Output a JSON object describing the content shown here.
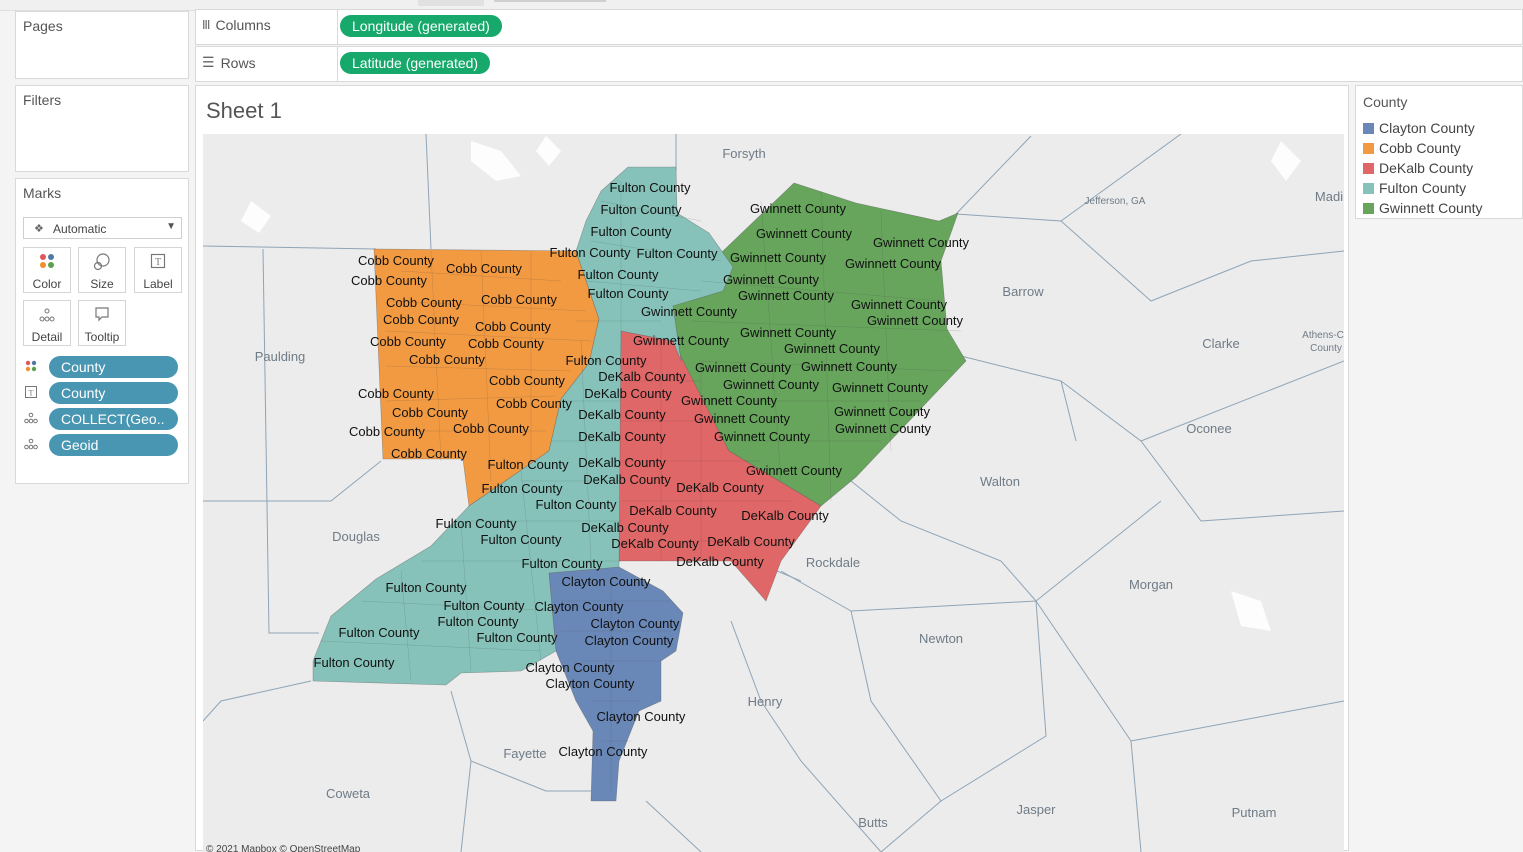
{
  "app": {
    "sheet_title": "Sheet 1"
  },
  "pages": {
    "title": "Pages"
  },
  "filters": {
    "title": "Filters"
  },
  "columns": {
    "label": "Columns",
    "pill": "Longitude (generated)"
  },
  "rows": {
    "label": "Rows",
    "pill": "Latitude (generated)"
  },
  "marks": {
    "title": "Marks",
    "mark_type": "Automatic",
    "buttons": [
      {
        "label": "Color",
        "icon": "color-dots-icon"
      },
      {
        "label": "Size",
        "icon": "size-icon"
      },
      {
        "label": "Label",
        "icon": "label-icon"
      },
      {
        "label": "Detail",
        "icon": "detail-icon"
      },
      {
        "label": "Tooltip",
        "icon": "tooltip-icon"
      }
    ],
    "fields": [
      {
        "name": "County",
        "icon": "color-dots-icon"
      },
      {
        "name": "County",
        "icon": "label-icon"
      },
      {
        "name": "COLLECT(Geo..",
        "icon": "detail-icon"
      },
      {
        "name": "Geoid",
        "icon": "detail-icon"
      }
    ]
  },
  "legend": {
    "title": "County",
    "items": [
      {
        "label": "Clayton County",
        "color": "#6a88b7"
      },
      {
        "label": "Cobb County",
        "color": "#f29a42"
      },
      {
        "label": "DeKalb County",
        "color": "#e06767"
      },
      {
        "label": "Fulton County",
        "color": "#86c2b9"
      },
      {
        "label": "Gwinnett County",
        "color": "#67a55d"
      }
    ]
  },
  "map": {
    "places": [
      "Forsyth",
      "Jefferson, GA",
      "Madi",
      "Barrow",
      "Athens-C",
      "County",
      "Clarke",
      "Paulding",
      "Oconee",
      "Walton",
      "Douglas",
      "Rockdale",
      "Morgan",
      "Newton",
      "Henry",
      "Fayette",
      "Coweta",
      "Butts",
      "Jasper",
      "Putnam"
    ],
    "attribution": "© 2021 Mapbox © OpenStreetMap",
    "county_labels": {
      "Cobb County": [
        [
          395,
          259
        ],
        [
          483,
          267
        ],
        [
          388,
          279
        ],
        [
          423,
          301
        ],
        [
          518,
          298
        ],
        [
          420,
          318
        ],
        [
          512,
          325
        ],
        [
          407,
          340
        ],
        [
          505,
          342
        ],
        [
          446,
          358
        ],
        [
          526,
          379
        ],
        [
          395,
          392
        ],
        [
          533,
          402
        ],
        [
          429,
          411
        ],
        [
          490,
          427
        ],
        [
          386,
          430
        ],
        [
          428,
          452
        ]
      ],
      "Fulton County": [
        [
          649,
          186
        ],
        [
          640,
          208
        ],
        [
          630,
          230
        ],
        [
          589,
          251
        ],
        [
          676,
          252
        ],
        [
          617,
          273
        ],
        [
          627,
          292
        ],
        [
          605,
          359
        ],
        [
          527,
          463
        ],
        [
          521,
          487
        ],
        [
          475,
          522
        ],
        [
          575,
          503
        ],
        [
          520,
          538
        ],
        [
          561,
          562
        ],
        [
          425,
          586
        ],
        [
          483,
          604
        ],
        [
          477,
          620
        ],
        [
          378,
          631
        ],
        [
          516,
          636
        ],
        [
          353,
          661
        ]
      ],
      "Gwinnett County": [
        [
          797,
          207
        ],
        [
          803,
          232
        ],
        [
          920,
          241
        ],
        [
          777,
          256
        ],
        [
          892,
          262
        ],
        [
          770,
          278
        ],
        [
          785,
          294
        ],
        [
          898,
          303
        ],
        [
          914,
          319
        ],
        [
          688,
          310
        ],
        [
          787,
          331
        ],
        [
          680,
          339
        ],
        [
          831,
          347
        ],
        [
          742,
          366
        ],
        [
          848,
          365
        ],
        [
          770,
          383
        ],
        [
          879,
          386
        ],
        [
          728,
          399
        ],
        [
          881,
          410
        ],
        [
          741,
          417
        ],
        [
          882,
          427
        ],
        [
          761,
          435
        ],
        [
          793,
          469
        ]
      ],
      "DeKalb County": [
        [
          641,
          375
        ],
        [
          627,
          392
        ],
        [
          621,
          413
        ],
        [
          621,
          435
        ],
        [
          621,
          461
        ],
        [
          626,
          478
        ],
        [
          719,
          486
        ],
        [
          672,
          509
        ],
        [
          784,
          514
        ],
        [
          624,
          526
        ],
        [
          654,
          542
        ],
        [
          750,
          540
        ],
        [
          719,
          560
        ]
      ],
      "Clayton County": [
        [
          605,
          580
        ],
        [
          578,
          605
        ],
        [
          634,
          622
        ],
        [
          628,
          639
        ],
        [
          569,
          666
        ],
        [
          589,
          682
        ],
        [
          640,
          715
        ],
        [
          602,
          750
        ]
      ]
    }
  }
}
